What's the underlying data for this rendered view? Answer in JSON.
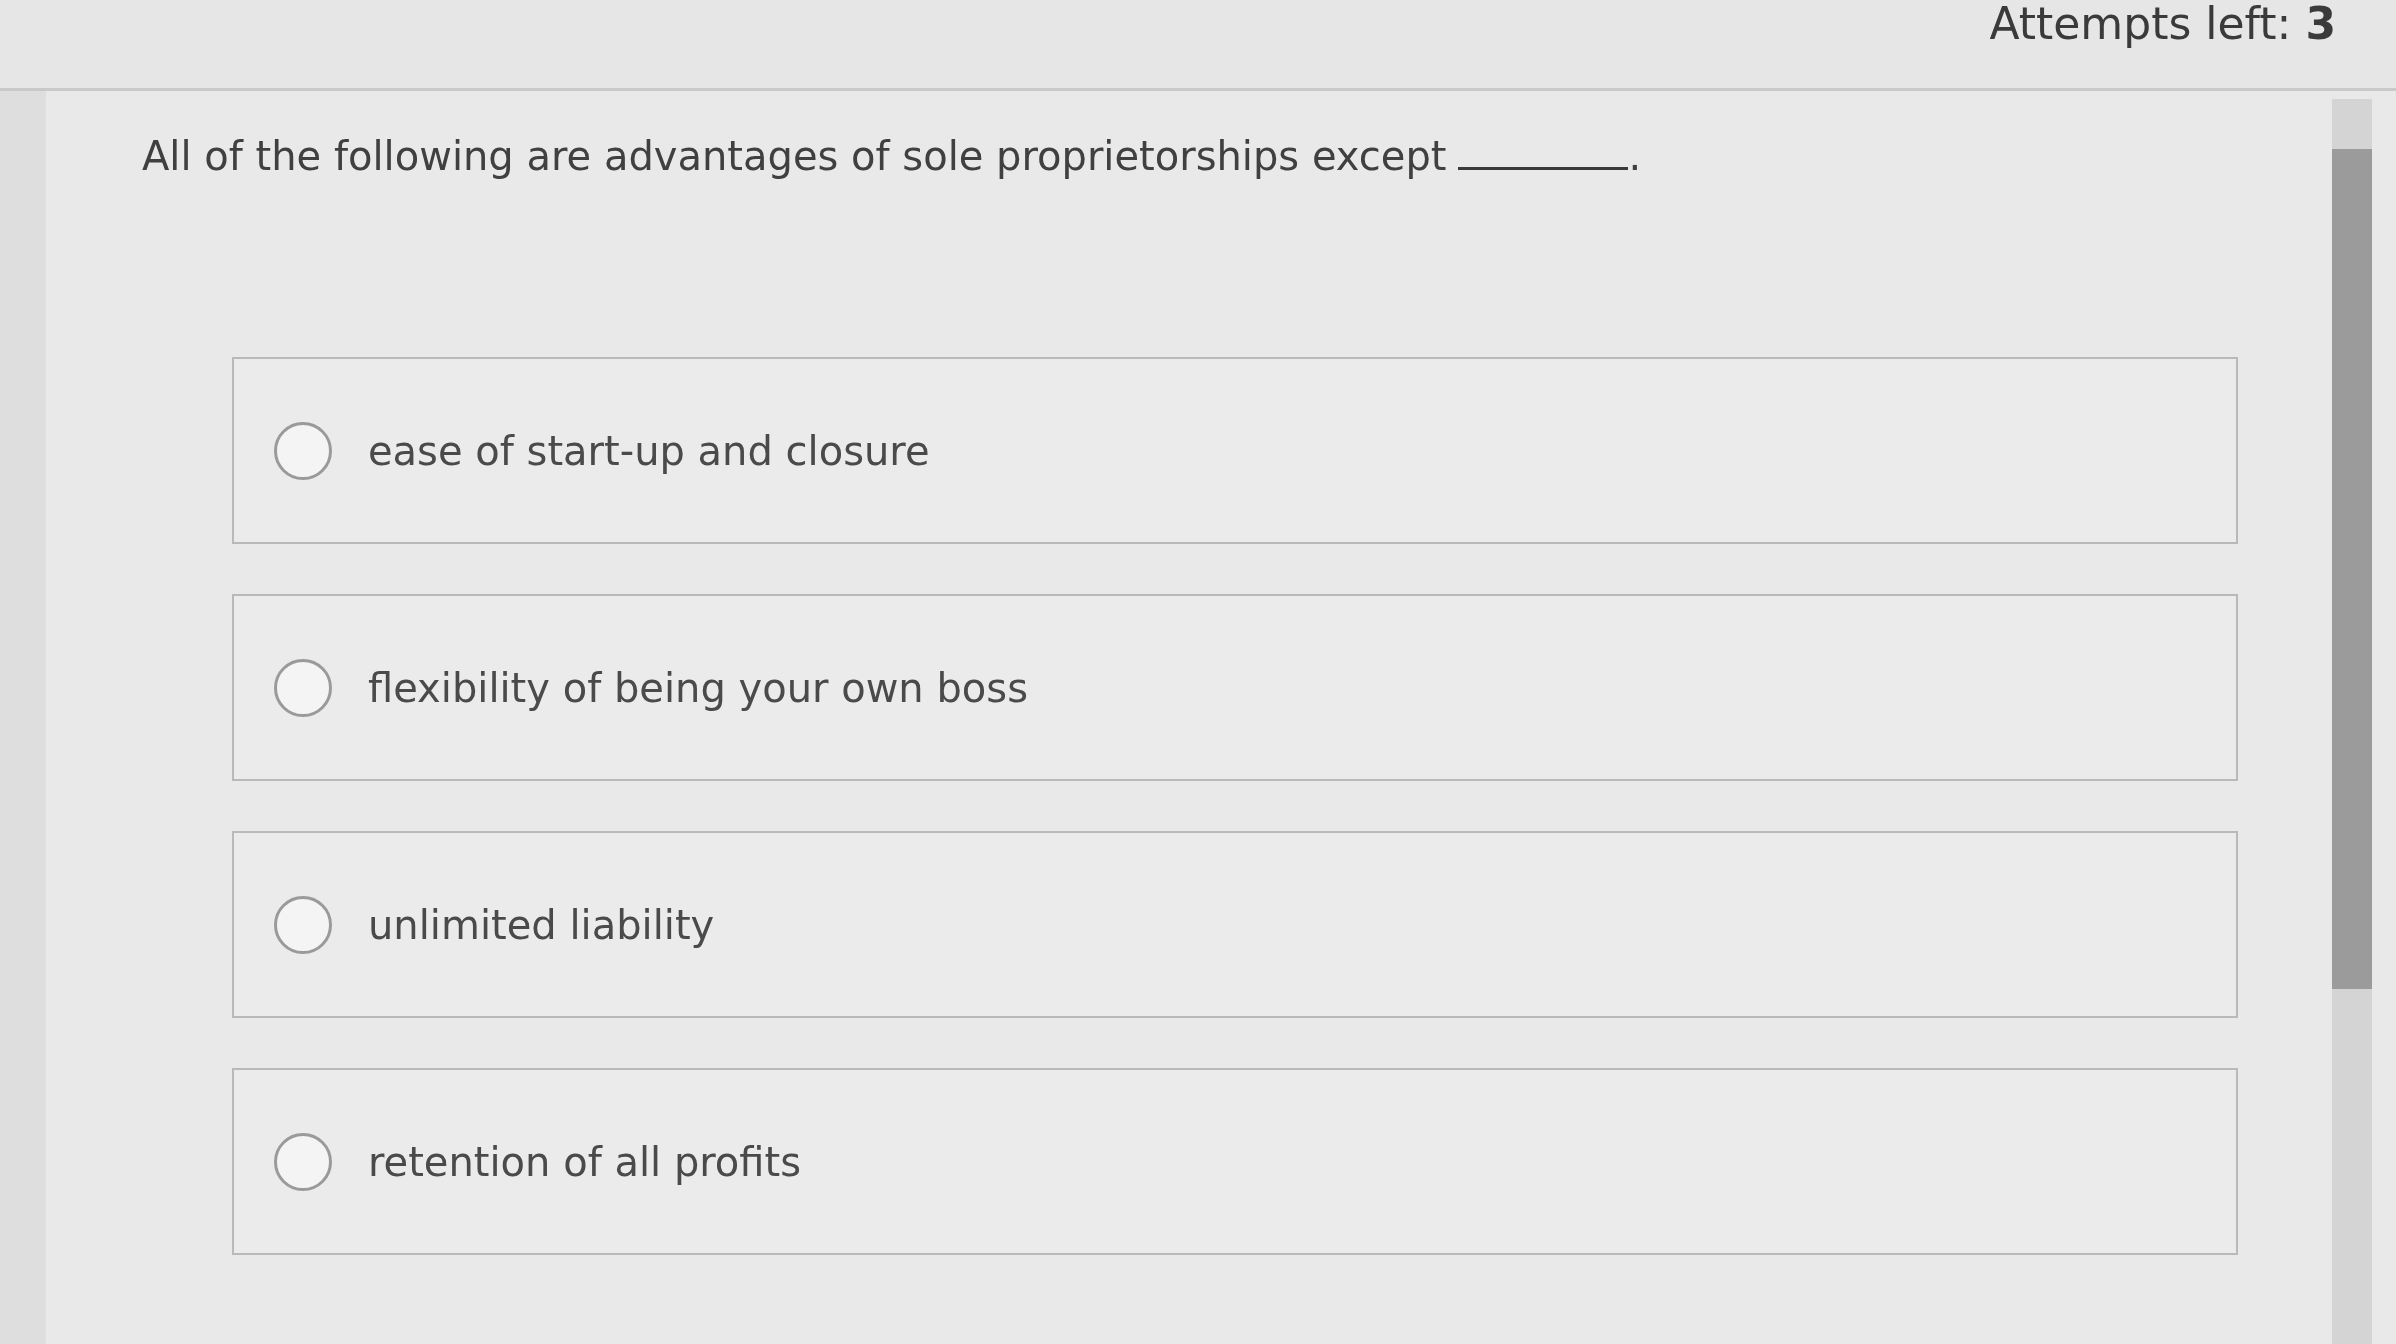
{
  "header": {
    "attempts": "Attempts left: **3**"
  },
  "question": {
    "text": "All of the following are advantages of sole proprietorships except",
    "after_blank": "."
  },
  "options": [
    {
      "label": "ease of start-up and closure",
      "selected": false
    },
    {
      "label": "flexibility of being your own boss",
      "selected": false
    },
    {
      "label": "unlimited liability",
      "selected": false
    },
    {
      "label": "retention of all profits",
      "selected": false
    }
  ]
}
